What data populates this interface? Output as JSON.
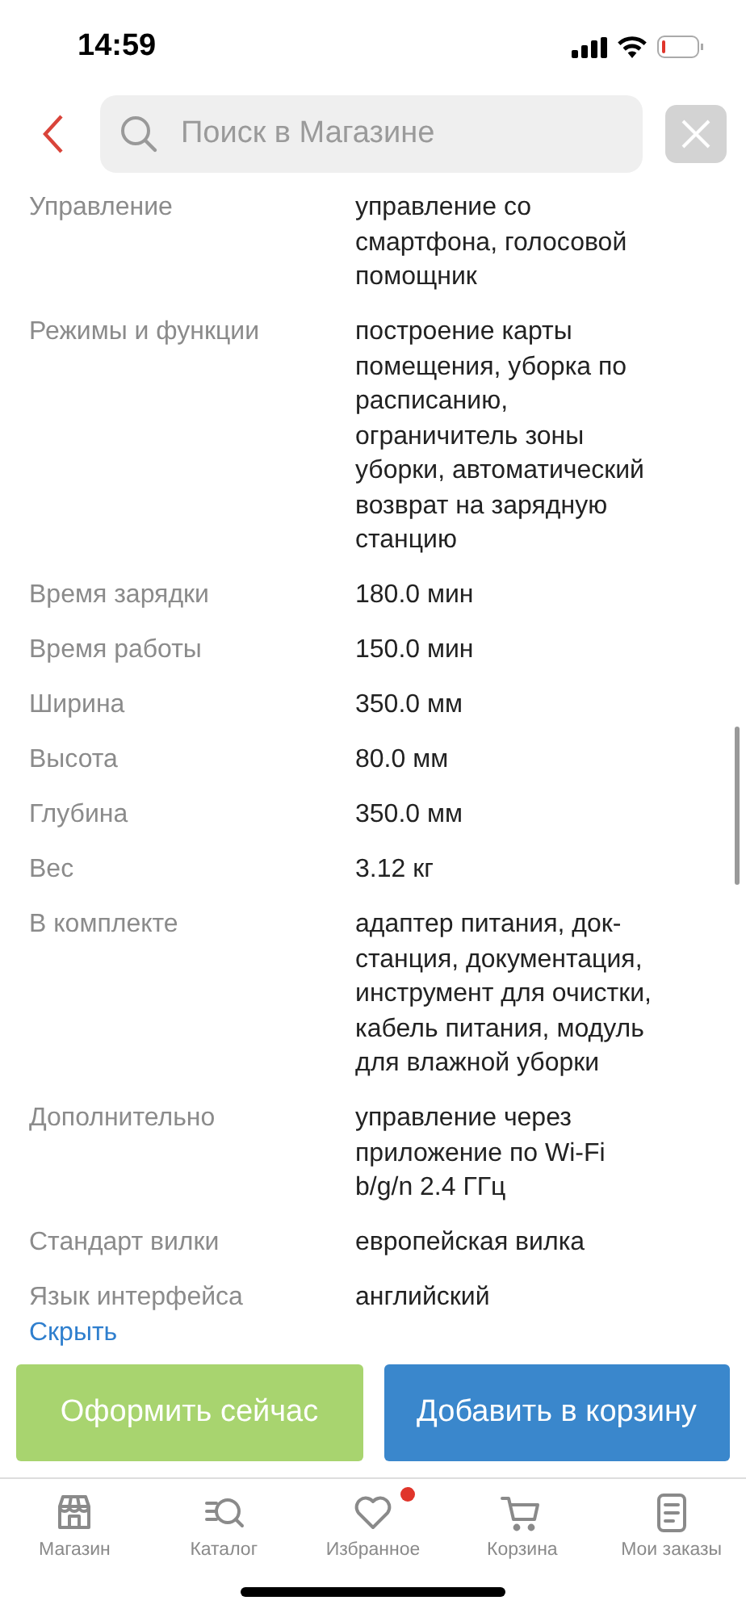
{
  "status_bar": {
    "time": "14:59"
  },
  "header": {
    "search": {
      "placeholder": "Поиск в Магазине"
    }
  },
  "specs": [
    {
      "label": "Управление",
      "value": "управление со смартфона, голосовой помощник"
    },
    {
      "label": "Режимы и функции",
      "value": "построение карты помещения, уборка по расписанию, ограничитель зоны уборки, автоматический возврат на зарядную станцию"
    },
    {
      "label": "Время зарядки",
      "value": "180.0 мин"
    },
    {
      "label": "Время работы",
      "value": "150.0 мин"
    },
    {
      "label": "Ширина",
      "value": "350.0 мм"
    },
    {
      "label": "Высота",
      "value": "80.0 мм"
    },
    {
      "label": "Глубина",
      "value": "350.0 мм"
    },
    {
      "label": "Вес",
      "value": "3.12 кг"
    },
    {
      "label": "В комплекте",
      "value": "адаптер питания, док-станция, документация, инструмент для очистки, кабель питания, модуль для влажной уборки"
    },
    {
      "label": "Дополнительно",
      "value": "управление через приложение по Wi-Fi b/g/n 2.4 ГГц"
    },
    {
      "label": "Стандарт вилки",
      "value": "европейская вилка"
    },
    {
      "label": "Язык интерфейса",
      "value": "английский"
    }
  ],
  "hide_link": "Скрыть",
  "actions": [
    {
      "label": "Оформить сейчас",
      "kind": "buy"
    },
    {
      "label": "Добавить в корзину",
      "kind": "cart"
    }
  ],
  "tab_bar": [
    {
      "label": "Магазин",
      "kind": "store",
      "badge": false
    },
    {
      "label": "Каталог",
      "kind": "catalog",
      "badge": false
    },
    {
      "label": "Избранное",
      "kind": "favorites",
      "badge": true
    },
    {
      "label": "Корзина",
      "kind": "cart",
      "badge": false
    },
    {
      "label": "Мои заказы",
      "kind": "orders",
      "badge": false
    }
  ]
}
